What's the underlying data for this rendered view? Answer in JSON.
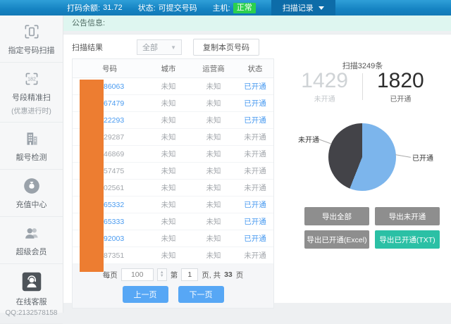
{
  "topbar": {
    "balance_label": "打码余额:",
    "balance_value": "31.72",
    "status_label": "状态:",
    "status_value": "可提交号码",
    "host_label": "主机:",
    "host_badge": "正常",
    "records_menu": "扫描记录"
  },
  "sidebar": {
    "items": [
      {
        "label": "指定号码扫描",
        "icon": "scan-frame-icon"
      },
      {
        "label": "号段精准扫",
        "sub": "(优惠进行时)",
        "icon": "number-segment-scan-icon"
      },
      {
        "label": "靓号检测",
        "icon": "building-icon"
      },
      {
        "label": "充值中心",
        "icon": "money-bag-icon"
      },
      {
        "label": "超级会员",
        "icon": "members-icon"
      },
      {
        "label": "在线客服",
        "sub": "QQ:2132578158",
        "icon": "customer-service-icon"
      }
    ]
  },
  "announcement": {
    "label": "公告信息:"
  },
  "toolbar": {
    "result_label": "扫描结果",
    "filter_value": "全部",
    "copy_button": "复制本页号码"
  },
  "table": {
    "columns": [
      "号码",
      "城市",
      "运营商",
      "状态"
    ],
    "rows": [
      {
        "number_suffix": "86063",
        "city": "未知",
        "carrier": "未知",
        "status": "已开通",
        "opened": true
      },
      {
        "number_suffix": "67479",
        "city": "未知",
        "carrier": "未知",
        "status": "已开通",
        "opened": true
      },
      {
        "number_suffix": "22293",
        "city": "未知",
        "carrier": "未知",
        "status": "已开通",
        "opened": true
      },
      {
        "number_suffix": "29287",
        "city": "未知",
        "carrier": "未知",
        "status": "未开通",
        "opened": false
      },
      {
        "number_suffix": "46869",
        "city": "未知",
        "carrier": "未知",
        "status": "未开通",
        "opened": false
      },
      {
        "number_suffix": "57475",
        "city": "未知",
        "carrier": "未知",
        "status": "未开通",
        "opened": false
      },
      {
        "number_suffix": "02561",
        "city": "未知",
        "carrier": "未知",
        "status": "未开通",
        "opened": false
      },
      {
        "number_suffix": "65332",
        "city": "未知",
        "carrier": "未知",
        "status": "已开通",
        "opened": true
      },
      {
        "number_suffix": "65333",
        "city": "未知",
        "carrier": "未知",
        "status": "已开通",
        "opened": true
      },
      {
        "number_suffix": "92003",
        "city": "未知",
        "carrier": "未知",
        "status": "已开通",
        "opened": true
      },
      {
        "number_suffix": "87351",
        "city": "未知",
        "carrier": "未知",
        "status": "未开通",
        "opened": false
      }
    ]
  },
  "pagination": {
    "per_page_label": "每页",
    "per_page_value": "100",
    "page_prefix": "第",
    "current_page": "1",
    "page_mid": "页, 共",
    "total_pages": "33",
    "page_suffix": "页",
    "prev_button": "上一页",
    "next_button": "下一页"
  },
  "stats": {
    "scan_total_text": "扫描3249条",
    "unopened": {
      "value": "1429",
      "label": "未开通"
    },
    "opened": {
      "value": "1820",
      "label": "已开通"
    }
  },
  "chart_data": {
    "type": "pie",
    "labels": [
      "已开通",
      "未开通"
    ],
    "values": [
      1820,
      1429
    ],
    "colors": [
      "#7cb5ec",
      "#434348"
    ],
    "title": "扫描3249条",
    "start_angle_deg": 0,
    "direction": "clockwise",
    "label_style": "callout"
  },
  "export_buttons": [
    {
      "label": "导出全部",
      "color": "#8e8e8e"
    },
    {
      "label": "导出未开通",
      "color": "#8e8e8e"
    },
    {
      "label": "导出已开通(Excel)",
      "color": "#8e8e8e"
    },
    {
      "label": "导出已开通(TXT)",
      "color": "#2bc0a5"
    }
  ],
  "colors": {
    "topbar_blue": "#1583c2",
    "topbar_menu_blue": "#0d6ca8",
    "badge_green": "#2bd04e",
    "link_blue": "#4a9bf0",
    "page_button_blue": "#57a7f5",
    "redaction_orange": "#ed7d31",
    "announce_bg": "#def6f0",
    "pie_opened_blue": "#7cb5ec",
    "pie_unopened_dark": "#434348",
    "export_gray": "#8e8e8e",
    "export_teal": "#2bc0a5"
  }
}
